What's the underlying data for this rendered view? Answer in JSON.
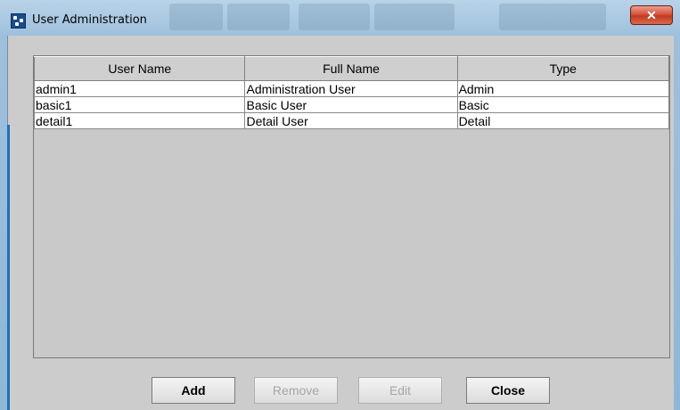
{
  "window": {
    "title": "User Administration",
    "close_glyph": "✕"
  },
  "table": {
    "columns": [
      "User Name",
      "Full Name",
      "Type"
    ],
    "rows": [
      [
        "admin1",
        "Administration User",
        "Admin"
      ],
      [
        "basic1",
        "Basic User",
        "Basic"
      ],
      [
        "detail1",
        "Detail User",
        "Detail"
      ]
    ]
  },
  "buttons": {
    "add": "Add",
    "remove": "Remove",
    "edit": "Edit",
    "close": "Close"
  },
  "colors": {
    "close_button": "#d6533a",
    "panel_bg": "#c9c9c9",
    "row_bg": "#ffffff"
  }
}
